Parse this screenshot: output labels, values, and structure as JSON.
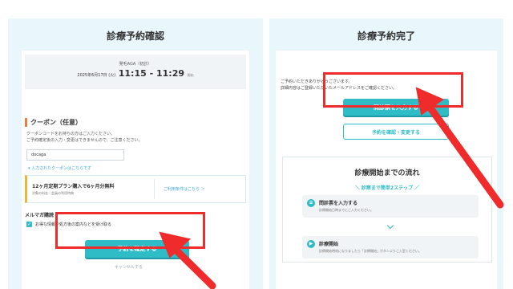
{
  "left": {
    "title": "診療予約確認",
    "appointment": {
      "name": "発毛AGA（初診）",
      "date": "2025年6月17日 (火)",
      "time": "11:15 - 11:29",
      "suffix": "開始"
    },
    "coupon": {
      "heading": "クーポン（任意）",
      "desc1": "クーポンコードをお持ちの方はご入力ください。",
      "desc2": "ご予約確定後の入力・変更はできませんので、ご注意ください。",
      "value": "docaga",
      "link": "▾ 入力されたクーポンはこちらです"
    },
    "plan": {
      "title": "12ヶ月定期プラン購入で6ヶ月分無料",
      "sub": "対象の料金・会員の利用特典",
      "link": "ご利用条件はこちら ＞"
    },
    "mail": {
      "heading": "メルマガ購読",
      "option": "お得な情報や処方後の案内などを受け取る"
    },
    "confirm_button": "予約を確定する",
    "faint_link": "キャンセルする"
  },
  "right": {
    "title": "診療予約完了",
    "thanks1": "ご予約いただきありがとうございます。",
    "thanks2": "詳細内容はご登録いただいたメールアドレスをご確認ください。",
    "questionnaire_button": "問診票を入力する",
    "confirm_change_button": "予約を確認・変更する",
    "flow": {
      "title": "診療開始までの流れ",
      "subtitle": "＼ 診察まで簡単2ステップ ／",
      "steps": [
        {
          "title": "問診票を入力する",
          "desc": "診療開始日時までにご入力ください。",
          "icon": "clipboard-icon"
        },
        {
          "title": "診療開始",
          "desc": "診療開始時刻になりましたら「診療開始」ボタンよりご入室ください。",
          "icon": "video-icon"
        }
      ]
    }
  },
  "colors": {
    "accent": "#2fbcc6",
    "highlight": "#ef2b2b",
    "panel_bg": "#e9f6fb"
  }
}
